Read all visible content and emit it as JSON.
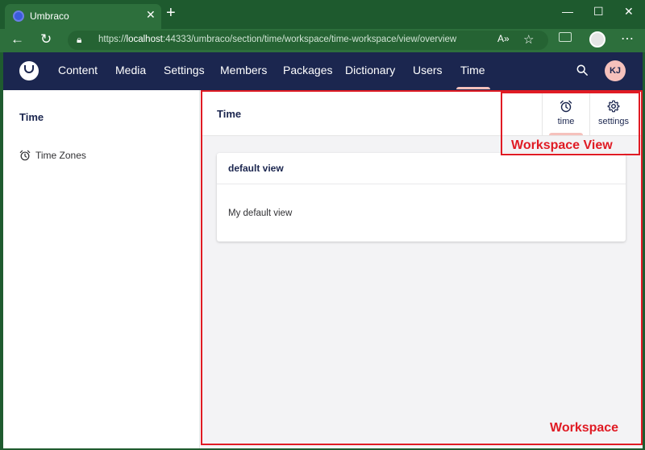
{
  "browser": {
    "tab_title": "Umbraco",
    "tab_close": "✕",
    "new_tab": "+",
    "url_scheme": "https://",
    "url_host": "localhost",
    "url_rest": ":44333/umbraco/section/time/workspace/time-workspace/view/overview",
    "window_minimize": "—",
    "window_maximize": "☐",
    "window_close": "✕"
  },
  "header": {
    "sections": [
      {
        "label": "Content"
      },
      {
        "label": "Media"
      },
      {
        "label": "Settings"
      },
      {
        "label": "Members"
      },
      {
        "label": "Packages"
      },
      {
        "label": "Dictionary"
      },
      {
        "label": "Users"
      },
      {
        "label": "Time"
      }
    ],
    "active_section": "Time",
    "avatar_initials": "KJ"
  },
  "sidebar": {
    "title": "Time",
    "items": [
      {
        "label": "Time Zones",
        "icon": "alarm-clock-icon"
      }
    ]
  },
  "workspace": {
    "title": "Time",
    "views": [
      {
        "label": "time",
        "icon": "alarm-clock-icon",
        "active": true
      },
      {
        "label": "settings",
        "icon": "gear-icon",
        "active": false
      }
    ],
    "box": {
      "headline": "default view",
      "content": "My default view"
    }
  },
  "annotations": {
    "workspace_view_label": "Workspace View",
    "workspace_label": "Workspace",
    "color": "#e01b24"
  },
  "colors": {
    "browser_frame": "#1e5a2e",
    "header_bg": "#1b264f",
    "accent": "#f5c1bc",
    "workspace_bg": "#f3f3f5"
  }
}
